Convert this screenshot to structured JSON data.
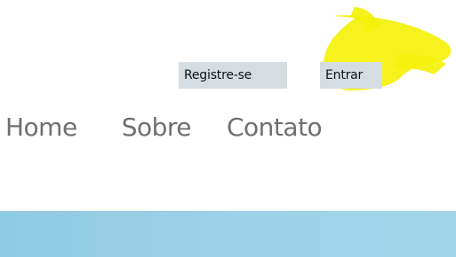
{
  "auth": {
    "register_label": "Registre-se",
    "login_label": "Entrar"
  },
  "nav": {
    "items": [
      {
        "label": "Home"
      },
      {
        "label": "Sobre"
      },
      {
        "label": "Contato"
      }
    ]
  },
  "colors": {
    "auth_link_bg": "#d6dde2",
    "nav_text": "#6f6f6f",
    "highlight": "#f4f10a",
    "hero_band": "#9ed2e7"
  },
  "annotation": {
    "type": "yellow-highlighter-scribble",
    "target": "login-link"
  }
}
